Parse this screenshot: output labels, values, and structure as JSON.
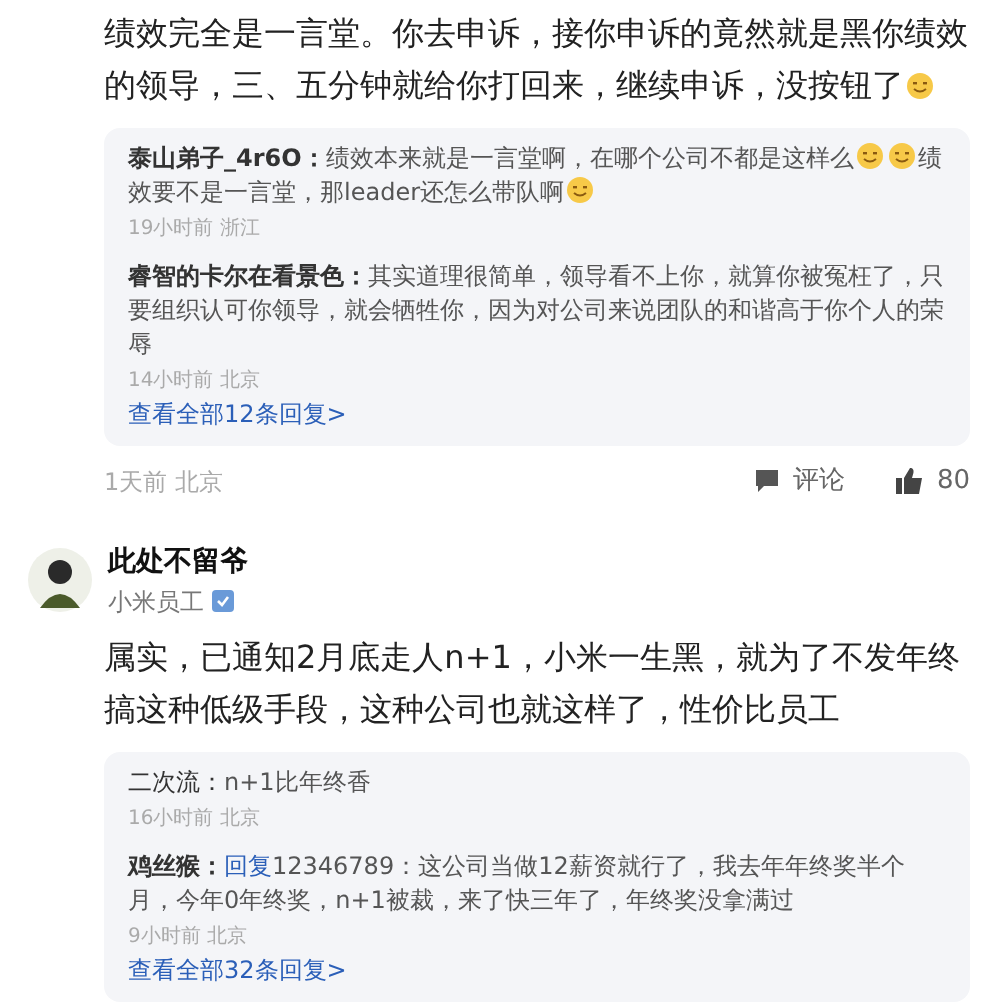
{
  "comments": [
    {
      "segments": [
        {
          "kind": "text",
          "text": "绩效完全是一言堂。你去申诉，接你申诉的竟然就是黑你绩效的领导，三、五分钟就给你打回来，继续申诉，没按钮了"
        },
        {
          "kind": "emoji"
        }
      ],
      "replies": [
        {
          "author": "泰山弟子_4r6O：",
          "bold": true,
          "segments": [
            {
              "kind": "text",
              "text": "绩效本来就是一言堂啊，在哪个公司不都是这样么"
            },
            {
              "kind": "emoji"
            },
            {
              "kind": "emoji"
            },
            {
              "kind": "text",
              "text": "绩效要不是一言堂，那leader还怎么带队啊"
            },
            {
              "kind": "emoji"
            }
          ],
          "meta": "19小时前 浙江"
        },
        {
          "author": "睿智的卡尔在看景色：",
          "bold": true,
          "segments": [
            {
              "kind": "text",
              "text": "其实道理很简单，领导看不上你，就算你被冤枉了，只要组织认可你领导，就会牺牲你，因为对公司来说团队的和谐高于你个人的荣辱"
            }
          ],
          "meta": "14小时前 北京"
        }
      ],
      "more": "查看全部12条回复>",
      "footer": {
        "meta": "1天前 北京",
        "comment_label": "评论",
        "likes": "80"
      }
    },
    {
      "user": {
        "name": "此处不留爷",
        "subtitle": "小米员工"
      },
      "segments": [
        {
          "kind": "text",
          "text": "属实，已通知2月底走人n+1，小米一生黑，就为了不发年终搞这种低级手段，这种公司也就这样了，性价比员工"
        }
      ],
      "replies": [
        {
          "author": "二次流：",
          "bold": false,
          "segments": [
            {
              "kind": "text",
              "text": "n+1比年终香"
            }
          ],
          "meta": "16小时前 北京"
        },
        {
          "author": "鸡丝猴：",
          "bold": true,
          "link": "回复",
          "segments": [
            {
              "kind": "text",
              "text": "12346789：这公司当做12薪资就行了，我去年年终奖半个月，今年0年终奖，n+1被裁，来了快三年了，年终奖没拿满过"
            }
          ],
          "meta": "9小时前 北京"
        }
      ],
      "more": "查看全部32条回复>"
    }
  ]
}
